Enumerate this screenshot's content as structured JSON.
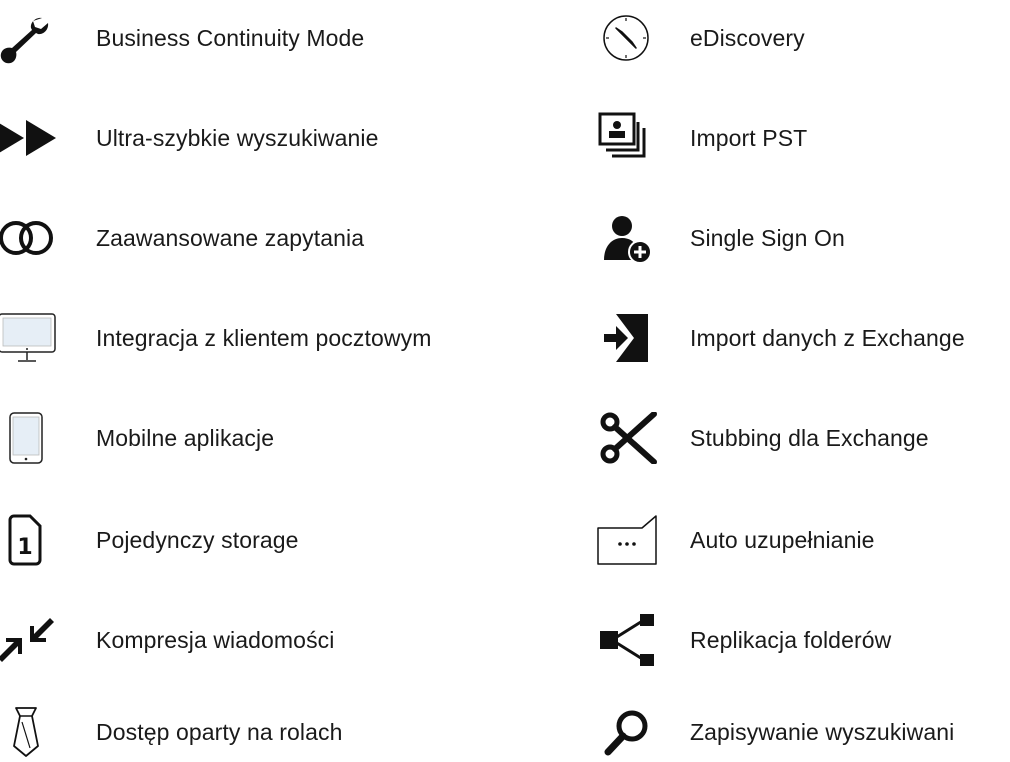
{
  "features": {
    "left": [
      {
        "label": "Business Continuity Mode",
        "icon": "wrench-icon"
      },
      {
        "label": "Ultra-szybkie wyszukiwanie",
        "icon": "fast-forward-icon"
      },
      {
        "label": "Zaawansowane zapytania",
        "icon": "intersecting-circles-icon"
      },
      {
        "label": "Integracja z klientem pocztowym",
        "icon": "desktop-monitor-icon"
      },
      {
        "label": "Mobilne aplikacje",
        "icon": "tablet-icon"
      },
      {
        "label": "Pojedynczy storage",
        "icon": "single-file-icon"
      },
      {
        "label": "Kompresja wiadomości",
        "icon": "compress-arrows-icon"
      },
      {
        "label": "Dostęp oparty na rolach",
        "icon": "necktie-icon"
      }
    ],
    "right": [
      {
        "label": "eDiscovery",
        "icon": "compass-icon"
      },
      {
        "label": "Import PST",
        "icon": "photo-stack-icon"
      },
      {
        "label": "Single Sign On",
        "icon": "user-add-icon"
      },
      {
        "label": "Import danych z Exchange",
        "icon": "import-arrow-icon"
      },
      {
        "label": "Stubbing dla Exchange",
        "icon": "scissors-icon"
      },
      {
        "label": "Auto uzupełnianie",
        "icon": "speech-bubble-ellipsis-icon"
      },
      {
        "label": "Replikacja folderów",
        "icon": "share-nodes-icon"
      },
      {
        "label": "Zapisywanie wyszukiwani",
        "icon": "magnifier-icon"
      }
    ]
  },
  "colors": {
    "text": "#1a1a1a",
    "icon": "#111111"
  }
}
